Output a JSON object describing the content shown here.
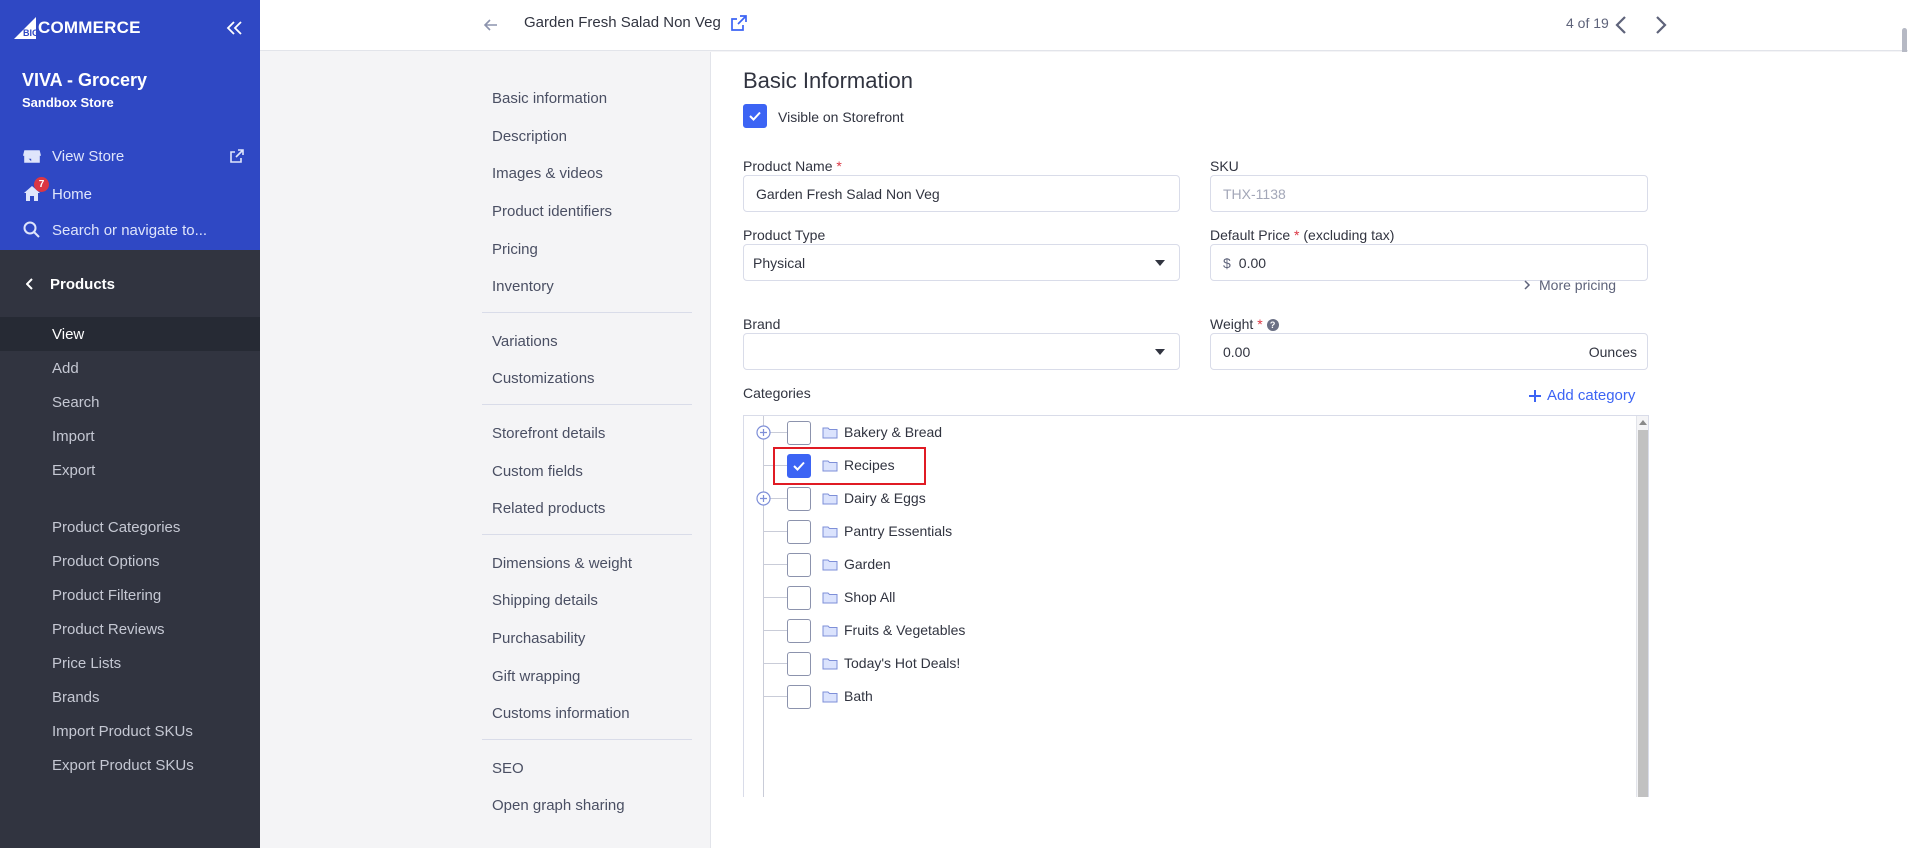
{
  "brand": {
    "logo_text": "COMMERCE"
  },
  "store": {
    "name": "VIVA - Grocery",
    "subtitle": "Sandbox Store"
  },
  "sidebar": {
    "view_store": "View Store",
    "home": "Home",
    "home_badge": "7",
    "search_placeholder": "Search or navigate to...",
    "section": "Products",
    "items": [
      "View",
      "Add",
      "Search",
      "Import",
      "Export"
    ],
    "items2": [
      "Product Categories",
      "Product Options",
      "Product Filtering",
      "Product Reviews",
      "Price Lists",
      "Brands",
      "Import Product SKUs",
      "Export Product SKUs"
    ]
  },
  "topbar": {
    "title": "Garden Fresh Salad Non Veg",
    "counter": "4 of 19"
  },
  "subnav": {
    "group1": [
      "Basic information",
      "Description",
      "Images & videos",
      "Product identifiers",
      "Pricing",
      "Inventory"
    ],
    "group2": [
      "Variations",
      "Customizations"
    ],
    "group3": [
      "Storefront details",
      "Custom fields",
      "Related products"
    ],
    "group4": [
      "Dimensions & weight",
      "Shipping details",
      "Purchasability",
      "Gift wrapping",
      "Customs information"
    ],
    "group5": [
      "SEO",
      "Open graph sharing"
    ]
  },
  "form": {
    "section_title": "Basic Information",
    "visible_label": "Visible on Storefront",
    "product_name_label": "Product Name",
    "required_mark": "*",
    "product_name_value": "Garden Fresh Salad Non Veg",
    "sku_label": "SKU",
    "sku_placeholder": "THX-1138",
    "product_type_label": "Product Type",
    "product_type_value": "Physical",
    "default_price_label": "Default Price",
    "default_price_suffix": "(excluding tax)",
    "currency": "$",
    "default_price_value": "0.00",
    "more_pricing": "More pricing",
    "brand_label": "Brand",
    "brand_value": "",
    "weight_label": "Weight",
    "weight_value": "0.00",
    "weight_unit": "Ounces",
    "categories_label": "Categories",
    "add_category": "Add category"
  },
  "categories": [
    {
      "name": "Bakery & Bread",
      "checked": false,
      "expandable": true
    },
    {
      "name": "Recipes",
      "checked": true,
      "expandable": false
    },
    {
      "name": "Dairy & Eggs",
      "checked": false,
      "expandable": true
    },
    {
      "name": "Pantry Essentials",
      "checked": false,
      "expandable": false
    },
    {
      "name": "Garden",
      "checked": false,
      "expandable": false
    },
    {
      "name": "Shop All",
      "checked": false,
      "expandable": false
    },
    {
      "name": "Fruits & Vegetables",
      "checked": false,
      "expandable": false
    },
    {
      "name": "Today's Hot Deals!",
      "checked": false,
      "expandable": false
    },
    {
      "name": "Bath",
      "checked": false,
      "expandable": false
    }
  ],
  "colors": {
    "accent": "#3c64f4",
    "sidebar_top": "#2f48c4",
    "sidebar_bg": "#313440",
    "highlight": "#e01b24"
  }
}
